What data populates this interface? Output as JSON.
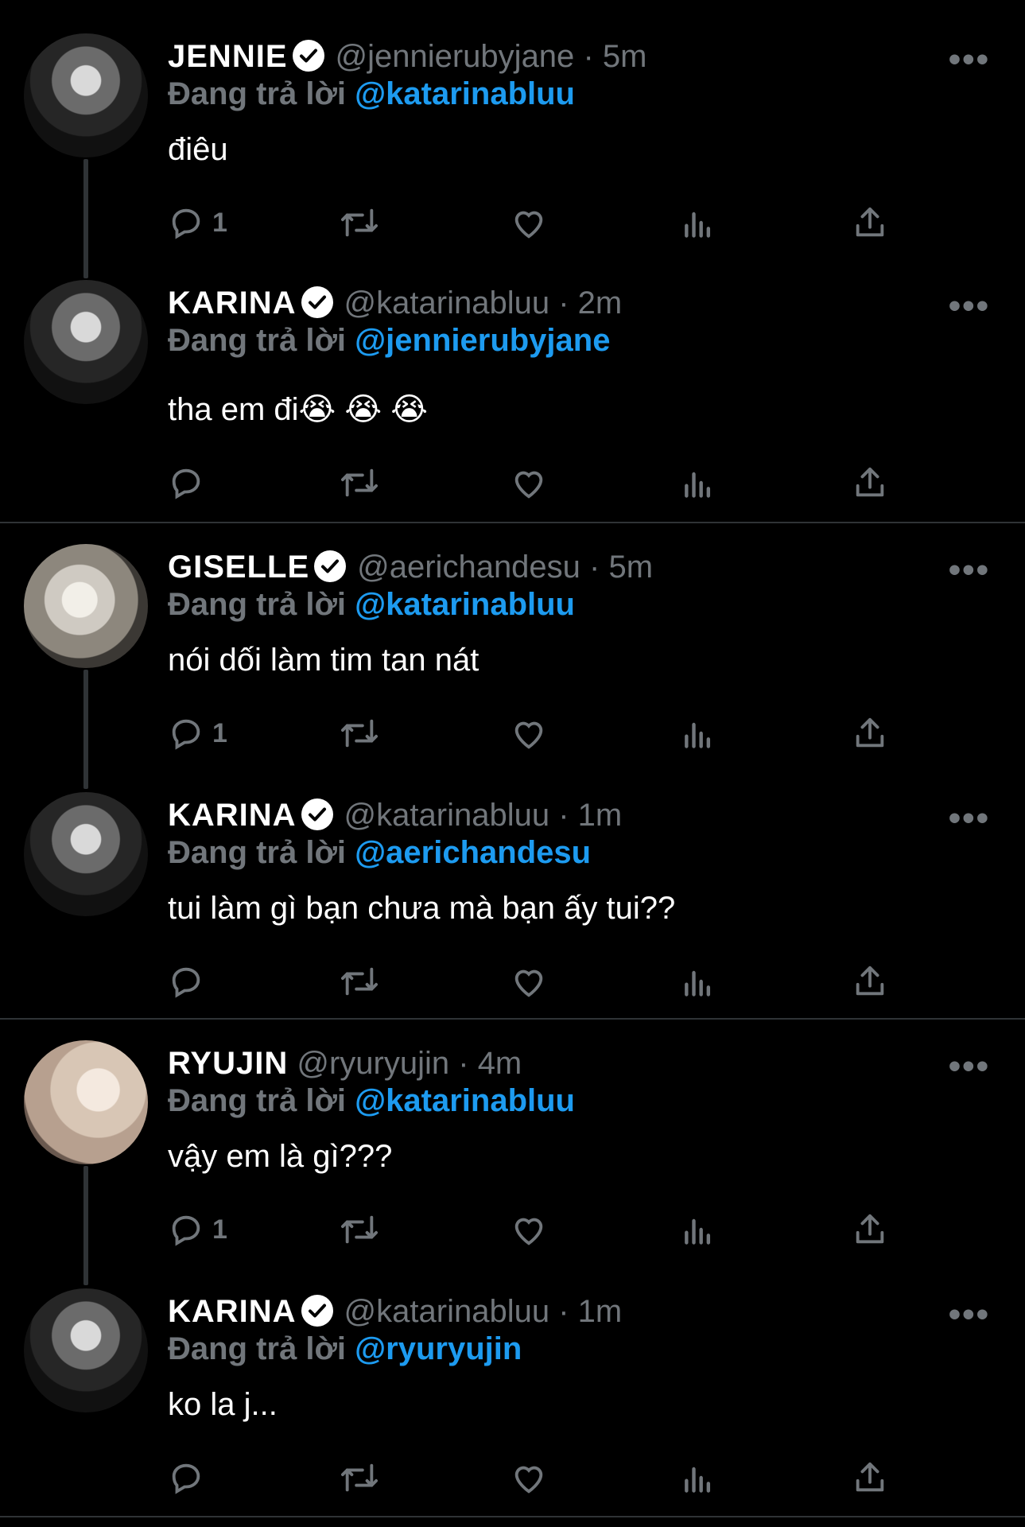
{
  "tweets": [
    {
      "name": "JENNIE",
      "verified": true,
      "handle": "@jennierubyjane",
      "time": "5m",
      "replying_label": "Đang trả lời",
      "replying_to": "@katarinabluu",
      "text": "điêu",
      "reply_count": "1"
    },
    {
      "name": "KARINA",
      "verified": true,
      "handle": "@katarinabluu",
      "time": "2m",
      "replying_label": "Đang trả lời",
      "replying_to": "@jennierubyjane",
      "text": "tha em đi😭 😭 😭",
      "reply_count": ""
    },
    {
      "name": "GISELLE",
      "verified": true,
      "handle": "@aerichandesu",
      "time": "5m",
      "replying_label": "Đang trả lời",
      "replying_to": "@katarinabluu",
      "text": "nói dối làm tim tan nát",
      "reply_count": "1"
    },
    {
      "name": "KARINA",
      "verified": true,
      "handle": "@katarinabluu",
      "time": "1m",
      "replying_label": "Đang trả lời",
      "replying_to": "@aerichandesu",
      "text": "tui làm gì bạn chưa mà bạn ấy tui??",
      "reply_count": ""
    },
    {
      "name": "RYUJIN",
      "verified": false,
      "handle": "@ryuryujin",
      "time": "4m",
      "replying_label": "Đang trả lời",
      "replying_to": "@katarinabluu",
      "text": "vậy em là gì???",
      "reply_count": "1"
    },
    {
      "name": "KARINA",
      "verified": true,
      "handle": "@katarinabluu",
      "time": "1m",
      "replying_label": "Đang trả lời",
      "replying_to": "@ryuryujin",
      "text": "ko la j...",
      "reply_count": ""
    }
  ],
  "separator": "·",
  "more_glyph": "•••",
  "icons": [
    "reply-icon",
    "retweet-icon",
    "like-icon",
    "analytics-icon",
    "share-icon"
  ],
  "colors": {
    "background": "#000000",
    "muted": "#71767b",
    "accent": "#1d9bf0",
    "divider": "#2f3336"
  }
}
